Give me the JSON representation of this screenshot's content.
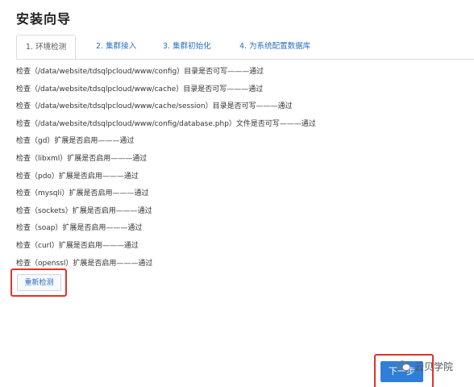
{
  "page_title": "安装向导",
  "tabs": [
    {
      "label": "1. 环境检测",
      "active": true
    },
    {
      "label": "2. 集群接入",
      "active": false
    },
    {
      "label": "3. 集群初始化",
      "active": false
    },
    {
      "label": "4. 为系统配置数据库",
      "active": false
    }
  ],
  "checks": [
    "检查（/data/website/tdsqlpcloud/www/config）目录是否可写———通过",
    "检查（/data/website/tdsqlpcloud/www/cache）目录是否可写———通过",
    "检查（/data/website/tdsqlpcloud/www/cache/session）目录是否可写———通过",
    "检查（/data/website/tdsqlpcloud/www/config/database.php）文件是否可写———通过",
    "检查（gd）扩展是否启用———通过",
    "检查（libxml）扩展是否启用———通过",
    "检查（pdo）扩展是否启用———通过",
    "检查（mysqli）扩展是否启用———通过",
    "检查（sockets）扩展是否启用———通过",
    "检查（soap）扩展是否启用———通过",
    "检查（curl）扩展是否启用———通过",
    "检查（openssl）扩展是否启用———通过"
  ],
  "retry_button": "重新检测",
  "next_button": "下一步",
  "watermark": "云贝学院",
  "colors": {
    "link": "#2a6fbe",
    "primary": "#2f7ed8",
    "highlight": "#e0332a"
  }
}
